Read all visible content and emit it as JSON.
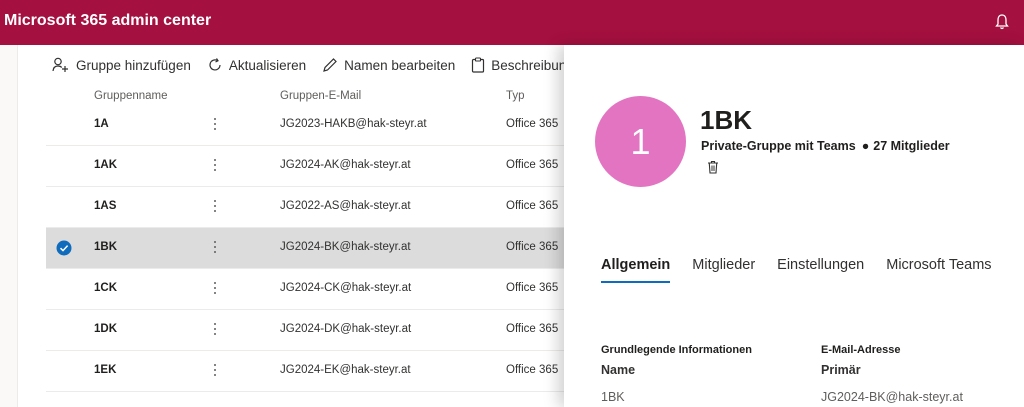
{
  "app": {
    "title": "Microsoft 365 admin center"
  },
  "toolbar": {
    "add_group": "Gruppe hinzufügen",
    "refresh": "Aktualisieren",
    "edit_name": "Namen bearbeiten",
    "description": "Beschreibung"
  },
  "columns": {
    "name": "Gruppenname",
    "email": "Gruppen-E-Mail",
    "type": "Typ"
  },
  "rows": [
    {
      "name": "1A",
      "email": "JG2023-HAKB@hak-steyr.at",
      "type": "Office 365",
      "selected": false
    },
    {
      "name": "1AK",
      "email": "JG2024-AK@hak-steyr.at",
      "type": "Office 365",
      "selected": false
    },
    {
      "name": "1AS",
      "email": "JG2022-AS@hak-steyr.at",
      "type": "Office 365",
      "selected": false
    },
    {
      "name": "1BK",
      "email": "JG2024-BK@hak-steyr.at",
      "type": "Office 365",
      "selected": true
    },
    {
      "name": "1CK",
      "email": "JG2024-CK@hak-steyr.at",
      "type": "Office 365",
      "selected": false
    },
    {
      "name": "1DK",
      "email": "JG2024-DK@hak-steyr.at",
      "type": "Office 365",
      "selected": false
    },
    {
      "name": "1EK",
      "email": "JG2024-EK@hak-steyr.at",
      "type": "Office 365",
      "selected": false
    }
  ],
  "panel": {
    "avatar_initial": "1",
    "avatar_color": "#e374c1",
    "title": "1BK",
    "group_type": "Private-Gruppe mit Teams",
    "members_count": "27 Mitglieder",
    "tabs": [
      "Allgemein",
      "Mitglieder",
      "Einstellungen",
      "Microsoft Teams"
    ],
    "active_tab": "Allgemein",
    "basic_info_heading": "Grundlegende Informationen",
    "name_label": "Name",
    "name_value": "1BK",
    "email_heading": "E-Mail-Adresse",
    "primary_label": "Primär",
    "primary_value": "JG2024-BK@hak-steyr.at"
  },
  "colors": {
    "brand": "#a4103f",
    "accent": "#0f6cbd",
    "selected_row": "#dcdcdc"
  },
  "icons": [
    "bell-icon",
    "add-person-icon",
    "refresh-icon",
    "pencil-icon",
    "clipboard-icon",
    "more-vertical-icon",
    "checkmark-circle-icon",
    "trash-icon"
  ]
}
